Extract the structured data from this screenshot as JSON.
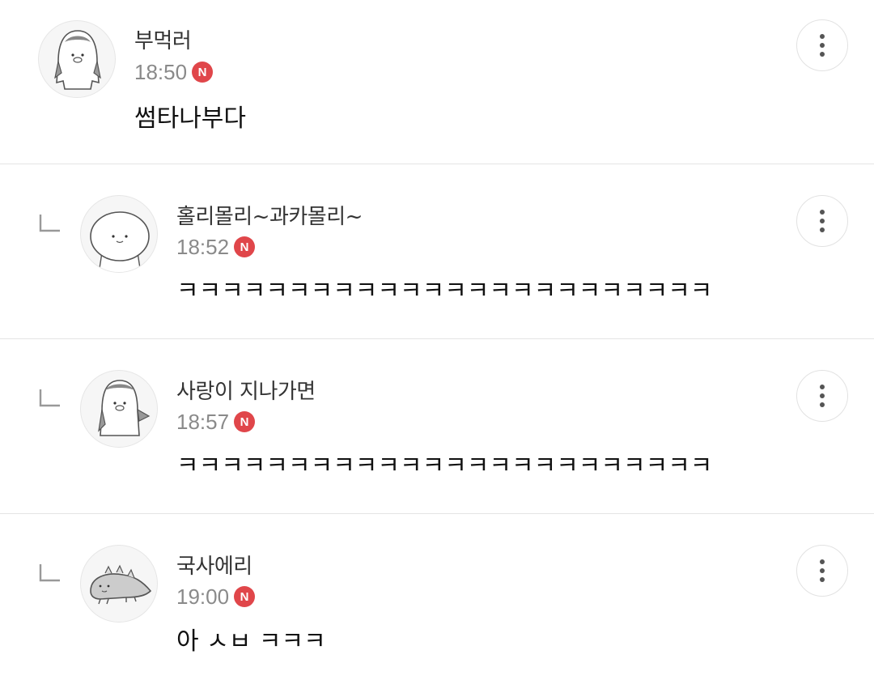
{
  "comments": [
    {
      "author": "부먹러",
      "time": "18:50",
      "badge": "N",
      "text": "썸타나부다",
      "is_reply": false,
      "avatar": "penguin-avatar"
    },
    {
      "author": "홀리몰리~과카몰리~",
      "time": "18:52",
      "badge": "N",
      "text": "ㅋㅋㅋㅋㅋㅋㅋㅋㅋㅋㅋㅋㅋㅋㅋㅋㅋㅋㅋㅋㅋㅋㅋㅋ",
      "is_reply": true,
      "avatar": "round-blob-avatar"
    },
    {
      "author": "사랑이 지나가면",
      "time": "18:57",
      "badge": "N",
      "text": "ㅋㅋㅋㅋㅋㅋㅋㅋㅋㅋㅋㅋㅋㅋㅋㅋㅋㅋㅋㅋㅋㅋㅋㅋ",
      "is_reply": true,
      "avatar": "penguin-avatar"
    },
    {
      "author": "국사에리",
      "time": "19:00",
      "badge": "N",
      "text": "아 ㅅㅂ ㅋㅋㅋ",
      "is_reply": true,
      "avatar": "dinosaur-avatar"
    }
  ],
  "icons": {
    "more": "more-vertical-icon",
    "reply": "reply-arrow-icon"
  },
  "colors": {
    "badge": "#e0464a",
    "time": "#8a8a8a",
    "divider": "#e4e4e4"
  }
}
